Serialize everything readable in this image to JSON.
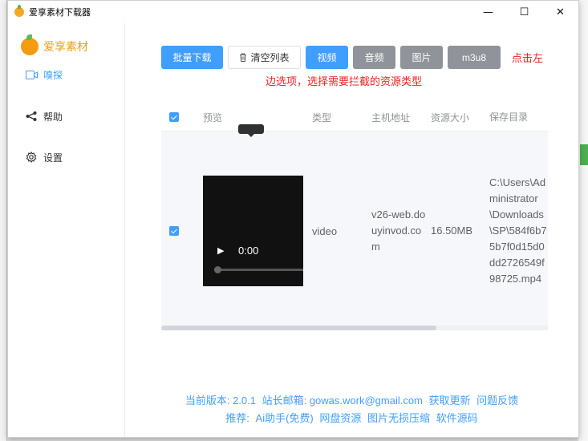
{
  "window": {
    "title": "爱享素材下载器"
  },
  "window_controls": {
    "minimize": "—",
    "maximize": "☐",
    "close": "✕"
  },
  "sidebar": {
    "brand": "爱享素材",
    "items": [
      {
        "label": "嗅探",
        "icon": "camera-icon",
        "active": true
      },
      {
        "label": "帮助",
        "icon": "share-icon",
        "active": false
      },
      {
        "label": "设置",
        "icon": "gear-icon",
        "active": false
      }
    ]
  },
  "toolbar": {
    "batch_download": "批量下载",
    "clear_list": "清空列表",
    "clear_icon": "trash-icon",
    "video": "视频",
    "audio": "音频",
    "image": "图片",
    "m3u8": "m3u8"
  },
  "hint": {
    "part1": "点击左",
    "part2": "边选项，选择需要拦截的资源类型"
  },
  "table": {
    "columns": {
      "preview": "预览",
      "type": "类型",
      "host": "主机地址",
      "size": "资源大小",
      "dir": "保存目录"
    },
    "rows": [
      {
        "video_time": "0:00",
        "type": "video",
        "host": "v26-web.douyinvod.com",
        "size": "16.50MB",
        "dir": "C:\\Users\\Administrator\\Downloads\\SP\\584f6b75b7f0d15d0dd2726549f98725.mp4"
      }
    ]
  },
  "footer": {
    "version": "当前版本: 2.0.1",
    "email": "站长邮箱: gowas.work@gmail.com",
    "update": "获取更新",
    "feedback": "问题反馈",
    "recommend_label": "推荐:",
    "ai": "Ai助手(免费)",
    "netdisk": "网盘资源",
    "compress": "图片无损压缩",
    "source": "软件源码"
  },
  "colors": {
    "primary": "#409eff",
    "hint": "#e22222",
    "brand": "#f39c12",
    "gray_button": "#909399"
  }
}
